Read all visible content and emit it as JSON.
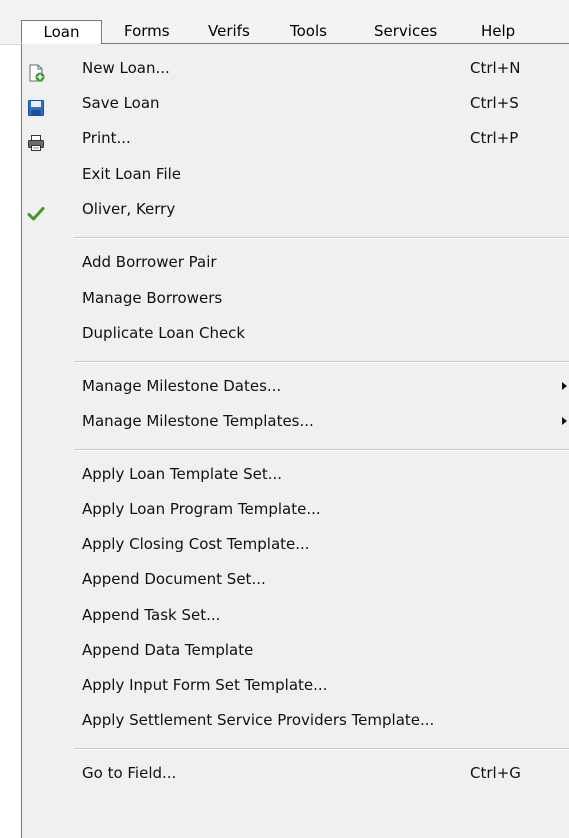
{
  "menubar": {
    "items": [
      {
        "label": "Loan"
      },
      {
        "label": "Forms"
      },
      {
        "label": "Verifs"
      },
      {
        "label": "Tools"
      },
      {
        "label": "Services"
      },
      {
        "label": "Help"
      }
    ]
  },
  "loan_menu": {
    "items": [
      {
        "label": "New Loan...",
        "shortcut": "Ctrl+N",
        "icon": "new-loan-icon"
      },
      {
        "label": "Save Loan",
        "shortcut": "Ctrl+S",
        "icon": "save-icon"
      },
      {
        "label": "Print...",
        "shortcut": "Ctrl+P",
        "icon": "printer-icon"
      },
      {
        "label": "Exit Loan File"
      },
      {
        "label": "Oliver, Kerry",
        "icon": "checkmark-icon"
      },
      {
        "label": "Add Borrower Pair"
      },
      {
        "label": "Manage Borrowers"
      },
      {
        "label": "Duplicate Loan Check"
      },
      {
        "label": "Manage Milestone Dates...",
        "submenu": true
      },
      {
        "label": "Manage Milestone Templates...",
        "submenu": true
      },
      {
        "label": "Apply Loan Template Set..."
      },
      {
        "label": "Apply Loan Program Template..."
      },
      {
        "label": "Apply Closing Cost Template..."
      },
      {
        "label": "Append Document Set..."
      },
      {
        "label": "Append Task Set..."
      },
      {
        "label": "Append Data Template"
      },
      {
        "label": "Apply Input Form Set Template..."
      },
      {
        "label": "Apply Settlement Service Providers Template..."
      },
      {
        "label": "Go to Field...",
        "shortcut": "Ctrl+G"
      }
    ]
  },
  "colors": {
    "menu_background": "#f0f0f0",
    "menubar_background": "#f3f3f3",
    "check_green": "#3f9a1f",
    "save_blue": "#2a6fc9"
  }
}
